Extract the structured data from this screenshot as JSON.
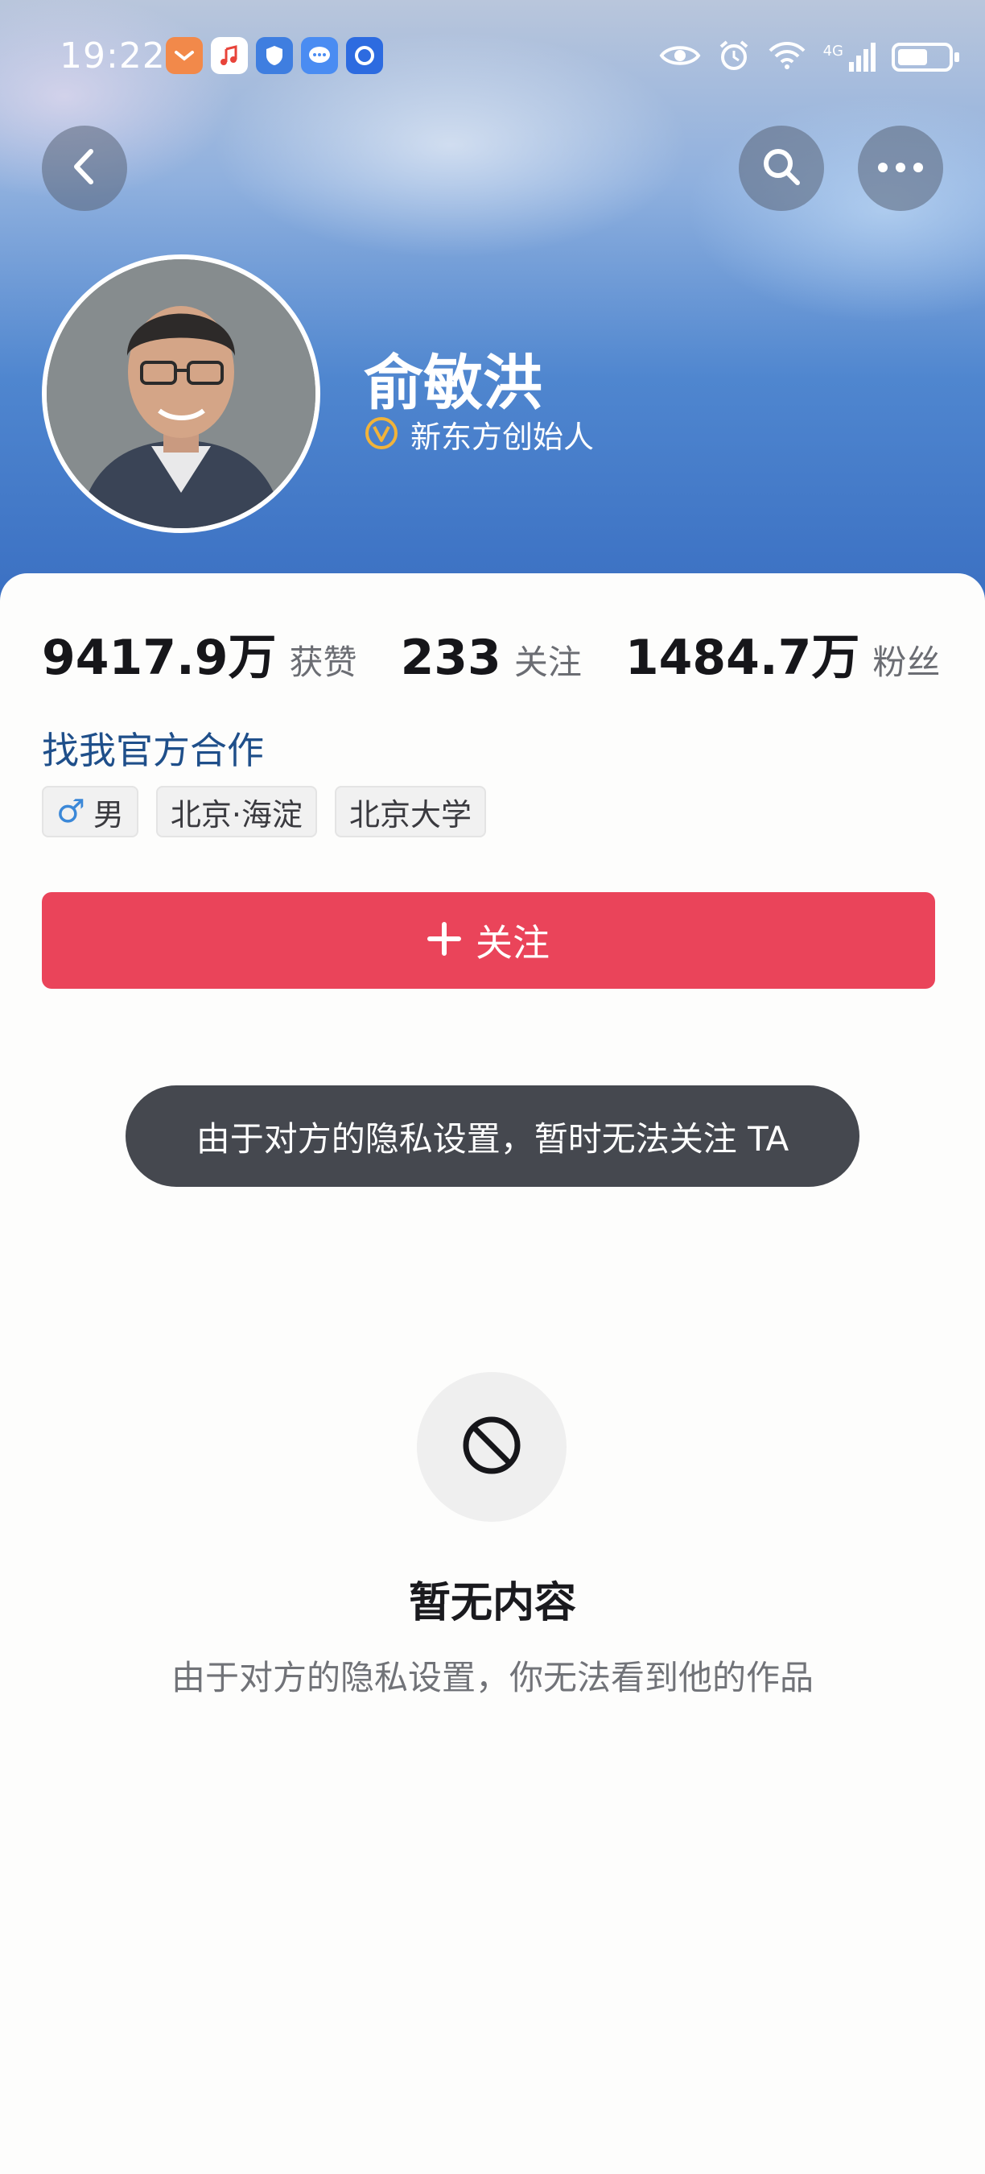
{
  "status_bar": {
    "time": "19:22",
    "icons": [
      "notification-app-icon",
      "music-app-icon",
      "shield-app-icon",
      "message-app-icon",
      "browser-app-icon",
      "eye-icon",
      "alarm-icon",
      "wifi-icon",
      "signal-4g-icon",
      "battery-icon"
    ],
    "network": "4G",
    "battery_level": 0.6
  },
  "profile": {
    "name": "俞敏洪",
    "verified_title": "新东方创始人"
  },
  "stats": [
    {
      "value": "9417.9万",
      "label": "获赞"
    },
    {
      "value": "233",
      "label": "关注"
    },
    {
      "value": "1484.7万",
      "label": "粉丝"
    }
  ],
  "coop_link": "找我官方合作",
  "tags": [
    {
      "icon": "male-icon",
      "text": "男"
    },
    {
      "text": "北京·海淀"
    },
    {
      "text": "北京大学"
    }
  ],
  "follow_button": {
    "label": "关注"
  },
  "toast": "由于对方的隐私设置，暂时无法关注 TA",
  "empty_state": {
    "title": "暂无内容",
    "description": "由于对方的隐私设置，你无法看到他的作品"
  },
  "colors": {
    "follow_button": "#ea445a",
    "coop_link": "#1f4f8a",
    "toast_bg": "#45484f"
  }
}
